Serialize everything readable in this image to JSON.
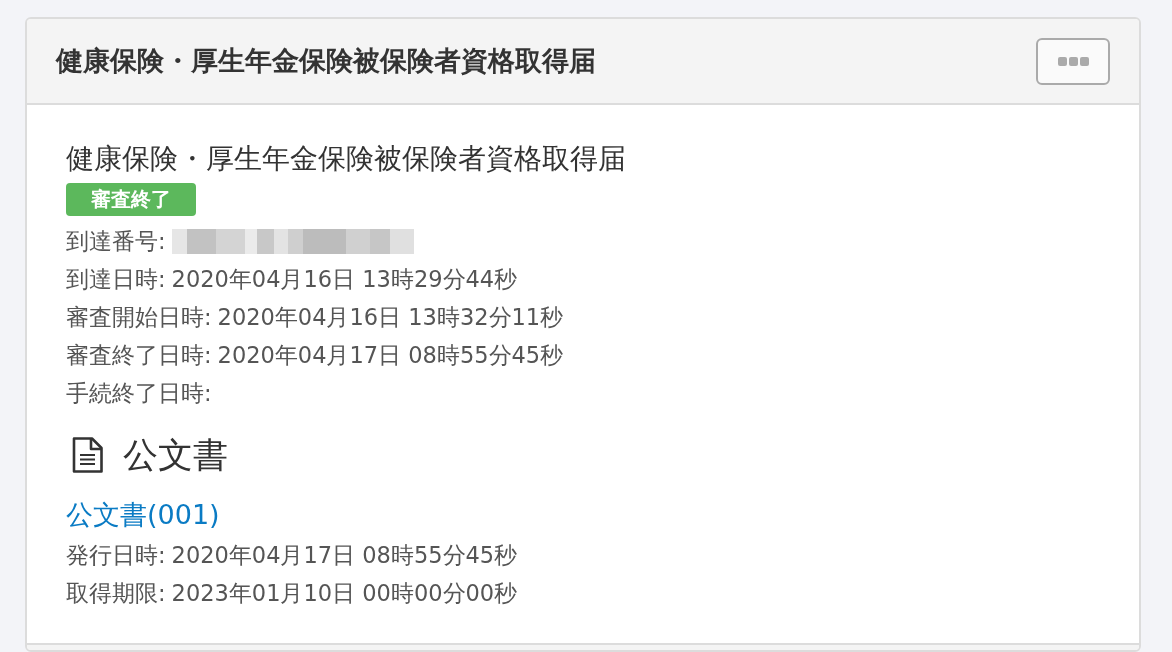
{
  "panel": {
    "title": "健康保険・厚生年金保険被保険者資格取得届"
  },
  "application": {
    "title": "健康保険・厚生年金保険被保険者資格取得届",
    "status": {
      "label": "審査終了",
      "kind": "success"
    },
    "fields": [
      {
        "label": "到達番号:",
        "redacted": true
      },
      {
        "label": "到達日時:",
        "value": "2020年04月16日 13時29分44秒"
      },
      {
        "label": "審査開始日時:",
        "value": "2020年04月16日 13時32分11秒"
      },
      {
        "label": "審査終了日時:",
        "value": "2020年04月17日 08時55分45秒"
      },
      {
        "label": "手続終了日時:"
      }
    ]
  },
  "documents": {
    "heading": "公文書",
    "items": [
      {
        "link": "公文書(001)",
        "fields": [
          {
            "label": "発行日時:",
            "value": "2020年04月17日 08時55分45秒"
          },
          {
            "label": "取得期限:",
            "value": "2023年01月10日 00時00分00秒"
          }
        ]
      }
    ]
  }
}
